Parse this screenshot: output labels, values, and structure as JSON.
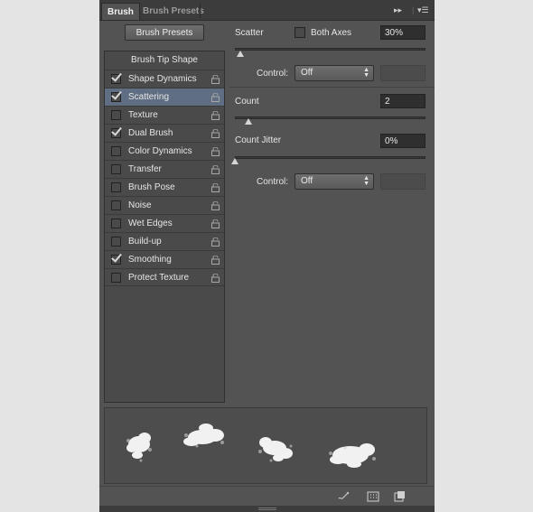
{
  "tabs": [
    {
      "label": "Brush"
    },
    {
      "label": "Brush Presets"
    }
  ],
  "header_controls": {
    "expand": "▸▸",
    "menu": "▾☰"
  },
  "brush_presets_button": "Brush Presets",
  "list": {
    "heading": "Brush Tip Shape",
    "items": [
      {
        "label": "Shape Dynamics",
        "checked": true
      },
      {
        "label": "Scattering",
        "checked": true,
        "selected": true
      },
      {
        "label": "Texture",
        "checked": false
      },
      {
        "label": "Dual Brush",
        "checked": true
      },
      {
        "label": "Color Dynamics",
        "checked": false
      },
      {
        "label": "Transfer",
        "checked": false
      },
      {
        "label": "Brush Pose",
        "checked": false
      },
      {
        "label": "Noise",
        "checked": false
      },
      {
        "label": "Wet Edges",
        "checked": false
      },
      {
        "label": "Build-up",
        "checked": false
      },
      {
        "label": "Smoothing",
        "checked": true
      },
      {
        "label": "Protect Texture",
        "checked": false
      }
    ]
  },
  "scatter": {
    "label": "Scatter",
    "both_axes_label": "Both Axes",
    "both_axes_checked": false,
    "value": "30%",
    "slider_fraction": 0.03
  },
  "control1": {
    "label": "Control:",
    "value": "Off"
  },
  "count": {
    "label": "Count",
    "value": "2",
    "slider_fraction": 0.07
  },
  "count_jitter": {
    "label": "Count Jitter",
    "value": "0%",
    "slider_fraction": 0.0
  },
  "control2": {
    "label": "Control:",
    "value": "Off"
  },
  "colors": {
    "panel": "#535353",
    "selected_row": "#5f6e82",
    "text": "#e6e6e6"
  },
  "footer_icons": [
    "brush-toggle-icon",
    "grid-icon",
    "new-preset-icon"
  ]
}
